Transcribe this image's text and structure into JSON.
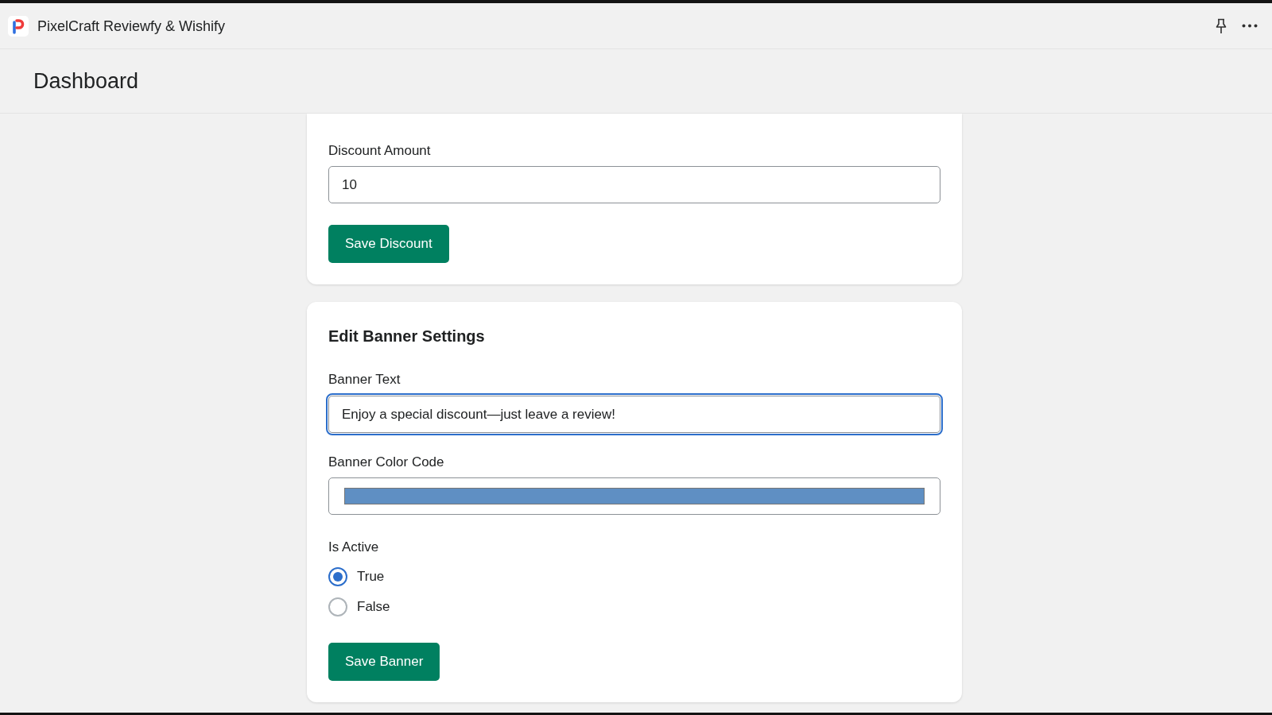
{
  "app_bar": {
    "title": "PixelCraft Reviewfy & Wishify"
  },
  "page_header": {
    "title": "Dashboard"
  },
  "discount_card": {
    "fields": [
      {
        "kind": "text",
        "label": "Discount Amount",
        "value": "10",
        "focused": false
      }
    ],
    "button": "Save Discount"
  },
  "banner_card": {
    "title": "Edit Banner Settings",
    "fields": [
      {
        "kind": "text",
        "label": "Banner Text",
        "value": "Enjoy a special discount—just leave a review!",
        "focused": true
      },
      {
        "kind": "color",
        "label": "Banner Color Code",
        "color": "#5f8fc3",
        "focused": false
      }
    ],
    "radio_group": {
      "label": "Is Active",
      "options": [
        {
          "label": "True",
          "selected": true
        },
        {
          "label": "False",
          "selected": false
        }
      ]
    },
    "button": "Save Banner"
  }
}
